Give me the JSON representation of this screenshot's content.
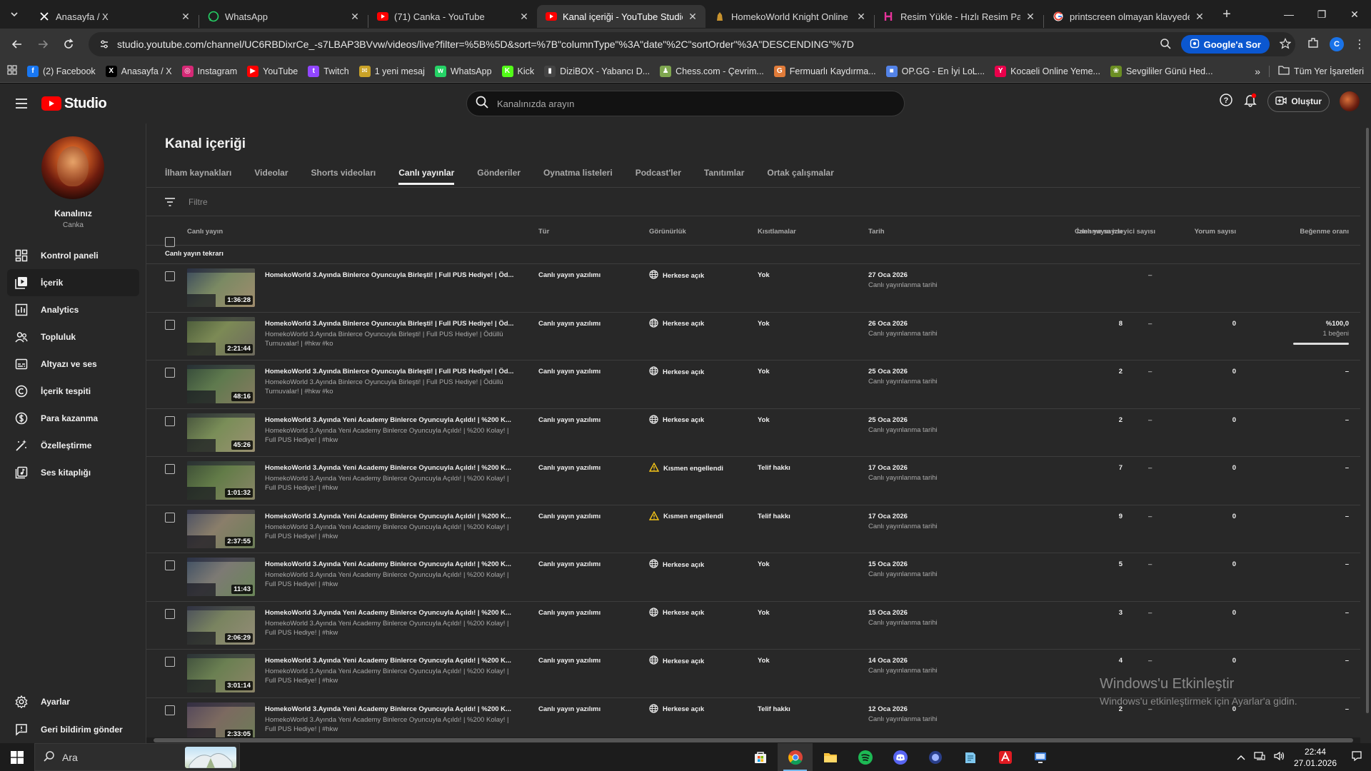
{
  "browser": {
    "tabs": [
      {
        "title": "Anasayfa / X",
        "icon": "x-icon",
        "active": false
      },
      {
        "title": "WhatsApp",
        "icon": "whatsapp-icon",
        "active": false
      },
      {
        "title": "(71) Canka - YouTube",
        "icon": "youtube-icon",
        "active": false
      },
      {
        "title": "Kanal içeriği - YouTube Studio",
        "icon": "youtube-studio-icon",
        "active": true
      },
      {
        "title": "HomekoWorld Knight Online P",
        "icon": "knight-icon",
        "active": false
      },
      {
        "title": "Resim Yükle - Hızlı Resim Payla",
        "icon": "resim-icon",
        "active": false
      },
      {
        "title": "printscreen olmayan klavyede",
        "icon": "google-icon",
        "active": false
      }
    ],
    "url": "studio.youtube.com/channel/UC6RBDixrCe_-s7LBAP3BVvw/videos/live?filter=%5B%5D&sort=%7B\"columnType\"%3A\"date\"%2C\"sortOrder\"%3A\"DESCENDING\"%7D",
    "ask_google": "Google'a Sor",
    "profile_letter": "C",
    "bookmarks": [
      {
        "label": "(2) Facebook",
        "icon": "facebook-icon",
        "color": "#1877f2",
        "glyph": "f"
      },
      {
        "label": "Anasayfa / X",
        "icon": "x-icon",
        "color": "#000000",
        "glyph": "X"
      },
      {
        "label": "Instagram",
        "icon": "instagram-icon",
        "color": "#d62976",
        "glyph": "◎"
      },
      {
        "label": "YouTube",
        "icon": "youtube-icon",
        "color": "#ff0000",
        "glyph": "▶"
      },
      {
        "label": "Twitch",
        "icon": "twitch-icon",
        "color": "#9146ff",
        "glyph": "t"
      },
      {
        "label": "1 yeni mesaj",
        "icon": "message-icon",
        "color": "#c9a227",
        "glyph": "✉"
      },
      {
        "label": "WhatsApp",
        "icon": "whatsapp-icon",
        "color": "#25d366",
        "glyph": "w"
      },
      {
        "label": "Kick",
        "icon": "kick-icon",
        "color": "#53fc18",
        "glyph": "K"
      },
      {
        "label": "DiziBOX - Yabancı D...",
        "icon": "dizibox-icon",
        "color": "#444444",
        "glyph": "▮"
      },
      {
        "label": "Chess.com - Çevrim...",
        "icon": "chess-icon",
        "color": "#7fa650",
        "glyph": "♟"
      },
      {
        "label": "Fermuarlı Kaydırma...",
        "icon": "fermuar-icon",
        "color": "#e07b39",
        "glyph": "G"
      },
      {
        "label": "OP.GG - En İyi LoL...",
        "icon": "opgg-icon",
        "color": "#5383e8",
        "glyph": "■"
      },
      {
        "label": "Kocaeli Online Yeme...",
        "icon": "yemeksepeti-icon",
        "color": "#ea004b",
        "glyph": "Y"
      },
      {
        "label": "Sevgililer Günü Hed...",
        "icon": "gift-icon",
        "color": "#6b8e23",
        "glyph": "❀"
      }
    ],
    "all_bookmarks": "Tüm Yer İşaretleri"
  },
  "studio": {
    "logo_text": "Studio",
    "search_placeholder": "Kanalınızda arayın",
    "create_label": "Oluştur",
    "channel": {
      "name": "Kanalınız",
      "handle": "Canka"
    },
    "nav": [
      {
        "label": "Kontrol paneli",
        "icon": "dashboard-icon",
        "active": false
      },
      {
        "label": "İçerik",
        "icon": "content-icon",
        "active": true
      },
      {
        "label": "Analytics",
        "icon": "analytics-icon",
        "active": false
      },
      {
        "label": "Topluluk",
        "icon": "community-icon",
        "active": false
      },
      {
        "label": "Altyazı ve ses",
        "icon": "subtitles-icon",
        "active": false
      },
      {
        "label": "İçerik tespiti",
        "icon": "copyright-icon",
        "active": false
      },
      {
        "label": "Para kazanma",
        "icon": "monetization-icon",
        "active": false
      },
      {
        "label": "Özelleştirme",
        "icon": "customization-icon",
        "active": false
      },
      {
        "label": "Ses kitaplığı",
        "icon": "audio-library-icon",
        "active": false
      }
    ],
    "nav_bottom": [
      {
        "label": "Ayarlar",
        "icon": "settings-icon"
      },
      {
        "label": "Geri bildirim gönder",
        "icon": "feedback-icon"
      }
    ],
    "page_title": "Kanal içeriği",
    "content_tabs": [
      {
        "label": "İlham kaynakları",
        "active": false
      },
      {
        "label": "Videolar",
        "active": false
      },
      {
        "label": "Shorts videoları",
        "active": false
      },
      {
        "label": "Canlı yayınlar",
        "active": true
      },
      {
        "label": "Gönderiler",
        "active": false
      },
      {
        "label": "Oynatma listeleri",
        "active": false
      },
      {
        "label": "Podcast'ler",
        "active": false
      },
      {
        "label": "Tanıtımlar",
        "active": false
      },
      {
        "label": "Ortak çalışmalar",
        "active": false
      }
    ],
    "filter_placeholder": "Filtre",
    "columns": {
      "video": "Canlı yayın",
      "type": "Tür",
      "visibility": "Görünürlük",
      "restrictions": "Kısıtlamalar",
      "date": "Tarih",
      "views": "İzlenme sayısı",
      "live_viewers": "Canlı yayın izleyici sayısı",
      "comments": "Yorum sayısı",
      "likes": "Beğenme oranı"
    },
    "group_label": "Canlı yayın tekrarı",
    "rows": [
      {
        "duration": "1:36:28",
        "title": "HomekoWorld 3.Ayında Binlerce Oyuncuyla Birleşti! | Full PUS Hediye! | Öd...",
        "desc": "",
        "type": "Canlı yayın yazılımı",
        "visibility": "Herkese açık",
        "vis_icon": "globe",
        "restriction": "Yok",
        "date": "27 Oca 2026",
        "date_sub": "Canlı yayınlanma tarihi",
        "views": "",
        "live": "–",
        "comments": "",
        "like": "",
        "like_sub": ""
      },
      {
        "duration": "2:21:44",
        "title": "HomekoWorld 3.Ayında Binlerce Oyuncuyla Birleşti! | Full PUS Hediye! | Öd...",
        "desc": "HomekoWorld 3.Ayında Binlerce Oyuncuyla Birleşti! | Full PUS Hediye! | Ödüllü Turnuvalar! | #hkw #ko",
        "type": "Canlı yayın yazılımı",
        "visibility": "Herkese açık",
        "vis_icon": "globe",
        "restriction": "Yok",
        "date": "26 Oca 2026",
        "date_sub": "Canlı yayınlanma tarihi",
        "views": "8",
        "live": "–",
        "comments": "0",
        "like": "%100,0",
        "like_sub": "1 beğeni",
        "like_ratio": 1.0
      },
      {
        "duration": "48:16",
        "title": "HomekoWorld 3.Ayında Binlerce Oyuncuyla Birleşti! | Full PUS Hediye! | Öd...",
        "desc": "HomekoWorld 3.Ayında Binlerce Oyuncuyla Birleşti! | Full PUS Hediye! | Ödüllü Turnuvalar! | #hkw #ko",
        "type": "Canlı yayın yazılımı",
        "visibility": "Herkese açık",
        "vis_icon": "globe",
        "restriction": "Yok",
        "date": "25 Oca 2026",
        "date_sub": "Canlı yayınlanma tarihi",
        "views": "2",
        "live": "–",
        "comments": "0",
        "like": "–",
        "like_sub": ""
      },
      {
        "duration": "45:26",
        "title": "HomekoWorld 3.Ayında Yeni Academy Binlerce Oyuncuyla Açıldı! | %200 K...",
        "desc": "HomekoWorld 3.Ayında Yeni Academy Binlerce Oyuncuyla Açıldı! | %200 Kolay! | Full PUS Hediye! | #hkw",
        "type": "Canlı yayın yazılımı",
        "visibility": "Herkese açık",
        "vis_icon": "globe",
        "restriction": "Yok",
        "date": "25 Oca 2026",
        "date_sub": "Canlı yayınlanma tarihi",
        "views": "2",
        "live": "–",
        "comments": "0",
        "like": "–",
        "like_sub": ""
      },
      {
        "duration": "1:01:32",
        "title": "HomekoWorld 3.Ayında Yeni Academy Binlerce Oyuncuyla Açıldı! | %200 K...",
        "desc": "HomekoWorld 3.Ayında Yeni Academy Binlerce Oyuncuyla Açıldı! | %200 Kolay! | Full PUS Hediye! | #hkw",
        "type": "Canlı yayın yazılımı",
        "visibility": "Kısmen engellendi",
        "vis_icon": "warning",
        "restriction": "Telif hakkı",
        "date": "17 Oca 2026",
        "date_sub": "Canlı yayınlanma tarihi",
        "views": "7",
        "live": "–",
        "comments": "0",
        "like": "–",
        "like_sub": ""
      },
      {
        "duration": "2:37:55",
        "title": "HomekoWorld 3.Ayında Yeni Academy Binlerce Oyuncuyla Açıldı! | %200 K...",
        "desc": "HomekoWorld 3.Ayında Yeni Academy Binlerce Oyuncuyla Açıldı! | %200 Kolay! | Full PUS Hediye! | #hkw",
        "type": "Canlı yayın yazılımı",
        "visibility": "Kısmen engellendi",
        "vis_icon": "warning",
        "restriction": "Telif hakkı",
        "date": "17 Oca 2026",
        "date_sub": "Canlı yayınlanma tarihi",
        "views": "9",
        "live": "–",
        "comments": "0",
        "like": "–",
        "like_sub": ""
      },
      {
        "duration": "11:43",
        "title": "HomekoWorld 3.Ayında Yeni Academy Binlerce Oyuncuyla Açıldı! | %200 K...",
        "desc": "HomekoWorld 3.Ayında Yeni Academy Binlerce Oyuncuyla Açıldı! | %200 Kolay! | Full PUS Hediye! | #hkw",
        "type": "Canlı yayın yazılımı",
        "visibility": "Herkese açık",
        "vis_icon": "globe",
        "restriction": "Yok",
        "date": "15 Oca 2026",
        "date_sub": "Canlı yayınlanma tarihi",
        "views": "5",
        "live": "–",
        "comments": "0",
        "like": "–",
        "like_sub": ""
      },
      {
        "duration": "2:06:29",
        "title": "HomekoWorld 3.Ayında Yeni Academy Binlerce Oyuncuyla Açıldı! | %200 K...",
        "desc": "HomekoWorld 3.Ayında Yeni Academy Binlerce Oyuncuyla Açıldı! | %200 Kolay! | Full PUS Hediye! | #hkw",
        "type": "Canlı yayın yazılımı",
        "visibility": "Herkese açık",
        "vis_icon": "globe",
        "restriction": "Yok",
        "date": "15 Oca 2026",
        "date_sub": "Canlı yayınlanma tarihi",
        "views": "3",
        "live": "–",
        "comments": "0",
        "like": "–",
        "like_sub": ""
      },
      {
        "duration": "3:01:14",
        "title": "HomekoWorld 3.Ayında Yeni Academy Binlerce Oyuncuyla Açıldı! | %200 K...",
        "desc": "HomekoWorld 3.Ayında Yeni Academy Binlerce Oyuncuyla Açıldı! | %200 Kolay! | Full PUS Hediye! | #hkw",
        "type": "Canlı yayın yazılımı",
        "visibility": "Herkese açık",
        "vis_icon": "globe",
        "restriction": "Yok",
        "date": "14 Oca 2026",
        "date_sub": "Canlı yayınlanma tarihi",
        "views": "4",
        "live": "–",
        "comments": "0",
        "like": "–",
        "like_sub": ""
      },
      {
        "duration": "2:33:05",
        "title": "HomekoWorld 3.Ayında Yeni Academy Binlerce Oyuncuyla Açıldı! | %200 K...",
        "desc": "HomekoWorld 3.Ayında Yeni Academy Binlerce Oyuncuyla Açıldı! | %200 Kolay! | Full PUS Hediye! | #hkw",
        "type": "Canlı yayın yazılımı",
        "visibility": "Herkese açık",
        "vis_icon": "globe",
        "restriction": "Telif hakkı",
        "date": "12 Oca 2026",
        "date_sub": "Canlı yayınlanma tarihi",
        "views": "2",
        "live": "–",
        "comments": "0",
        "like": "–",
        "like_sub": ""
      }
    ]
  },
  "watermark": {
    "line1": "Windows'u Etkinleştir",
    "line2": "Windows'u etkinleştirmek için Ayarlar'a gidin."
  },
  "taskbar": {
    "search_label": "Ara",
    "apps": [
      "store-icon",
      "chrome-icon",
      "explorer-icon",
      "spotify-icon",
      "discord-icon",
      "app-icon",
      "notepad-icon",
      "acrobat-icon",
      "remote-icon"
    ],
    "time": "22:44",
    "date": "27.01.2026"
  },
  "colors": {
    "accent_red": "#ff0000",
    "warning": "#f5c518",
    "background": "#282828"
  }
}
